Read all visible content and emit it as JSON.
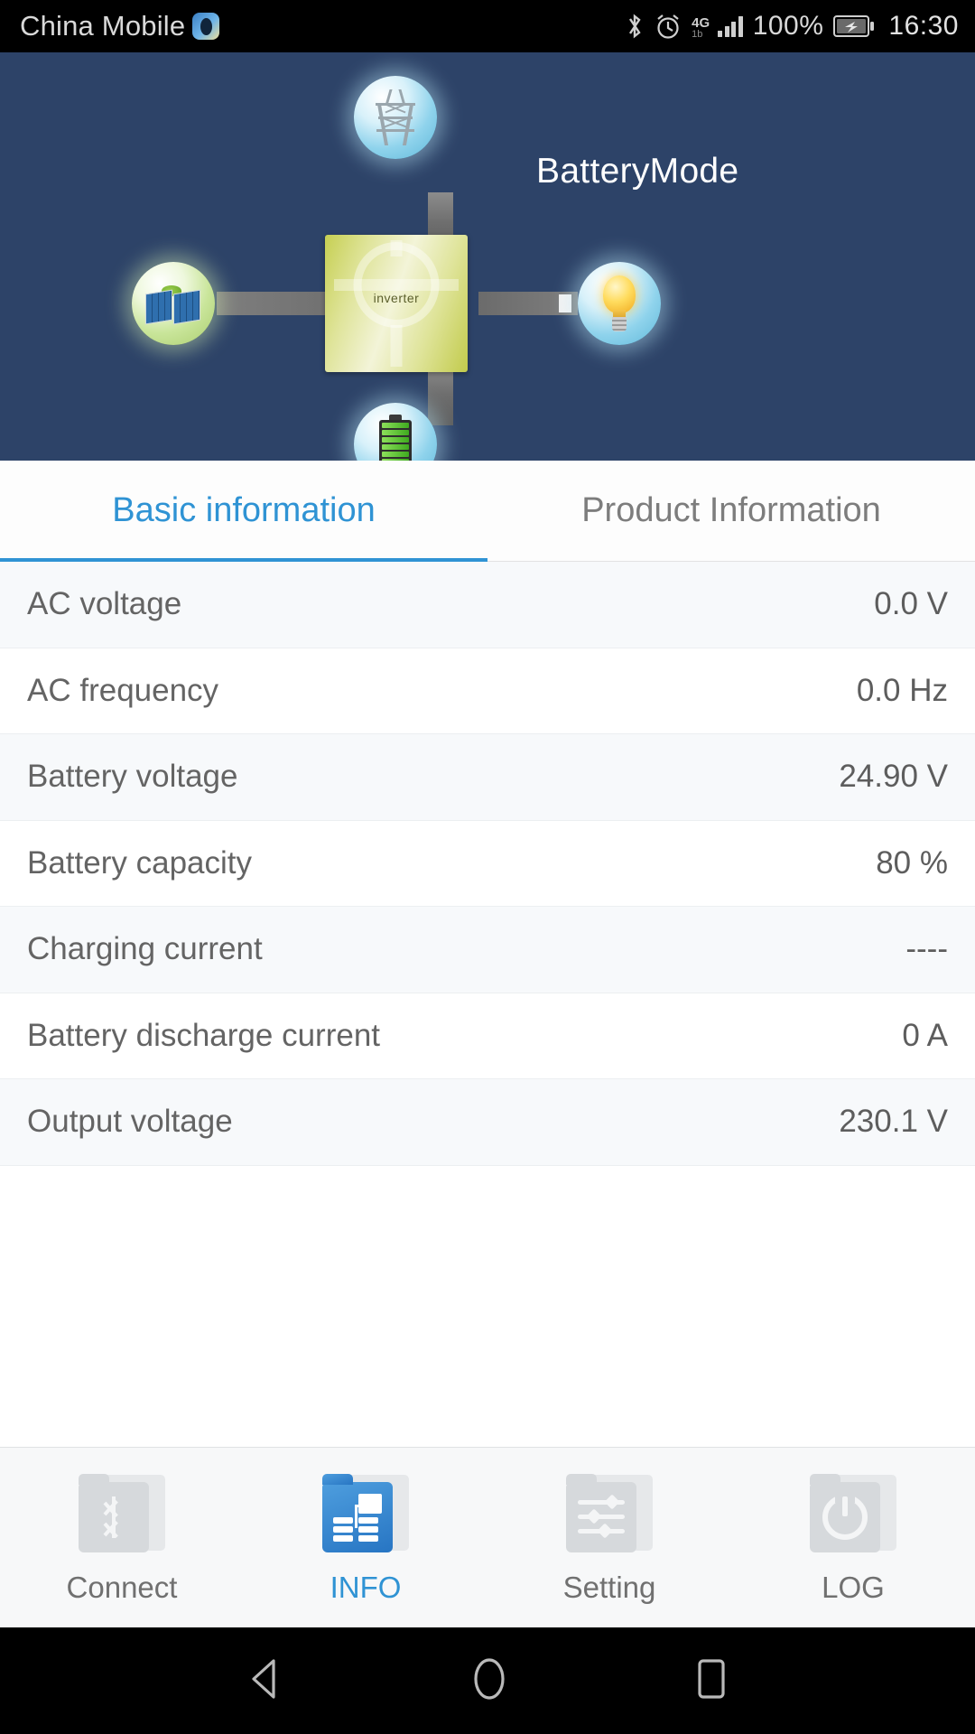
{
  "statusbar": {
    "carrier": "China Mobile",
    "eye_icon": "eye-badge-icon",
    "bluetooth_icon": "bluetooth-icon",
    "alarm_icon": "alarm-clock-icon",
    "network_type": "4G",
    "network_sub": "1b",
    "signal_icon": "signal-bars-icon",
    "battery_percent": "100%",
    "battery_icon": "battery-charging-icon",
    "time": "16:30"
  },
  "header": {
    "mode_title": "BatteryMode",
    "inverter_label": "inverter",
    "background_color": "#2d4368",
    "nodes": {
      "grid": "power-grid-tower-icon",
      "pv": "solar-panel-icon",
      "load": "light-bulb-icon",
      "battery": "battery-icon"
    }
  },
  "tabs": [
    {
      "label": "Basic information",
      "active": true
    },
    {
      "label": "Product Information",
      "active": false
    }
  ],
  "info_rows": [
    {
      "label": "AC voltage",
      "value": "0.0 V"
    },
    {
      "label": "AC frequency",
      "value": "0.0 Hz"
    },
    {
      "label": "Battery voltage",
      "value": "24.90 V"
    },
    {
      "label": "Battery capacity",
      "value": "80 %"
    },
    {
      "label": "Charging current",
      "value": "----"
    },
    {
      "label": "Battery discharge current",
      "value": "0 A"
    },
    {
      "label": "Output voltage",
      "value": "230.1 V"
    }
  ],
  "bottom_nav": [
    {
      "label": "Connect",
      "icon": "bluetooth-folder-icon",
      "active": false
    },
    {
      "label": "INFO",
      "icon": "info-folder-icon",
      "active": true
    },
    {
      "label": "Setting",
      "icon": "settings-folder-icon",
      "active": false
    },
    {
      "label": "LOG",
      "icon": "power-folder-icon",
      "active": false
    }
  ],
  "android_nav": {
    "back": "back-triangle-icon",
    "home": "home-circle-icon",
    "recents": "recents-square-icon"
  },
  "colors": {
    "accent": "#2f93d4",
    "header_bg": "#2d4368",
    "row_alt": "#f7f9fb",
    "text": "#646464"
  }
}
